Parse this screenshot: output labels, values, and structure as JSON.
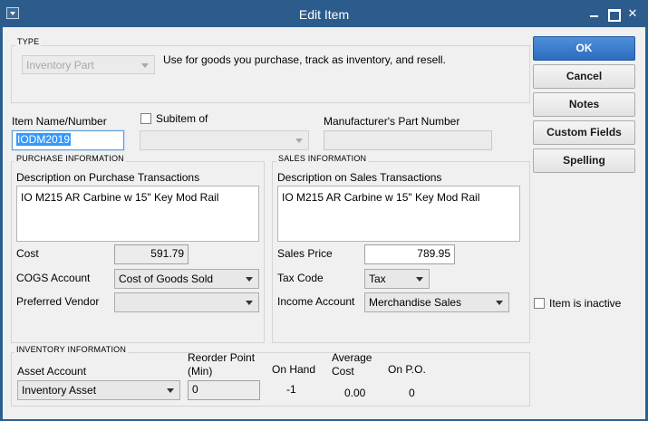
{
  "window": {
    "title": "Edit Item",
    "close_glyph": "✕"
  },
  "type_section": {
    "label": "TYPE",
    "type_value": "Inventory Part",
    "description": "Use for goods you purchase, track as inventory, and resell."
  },
  "item": {
    "name_label": "Item Name/Number",
    "name_value": "IODM2019",
    "subitem_label": "Subitem of",
    "subitem_value": "",
    "mpn_label": "Manufacturer's Part Number",
    "mpn_value": ""
  },
  "purchase": {
    "label": "PURCHASE INFORMATION",
    "desc_label": "Description on Purchase Transactions",
    "desc_value": "IO M215 AR Carbine w 15\" Key Mod Rail",
    "cost_label": "Cost",
    "cost_value": "591.79",
    "cogs_label": "COGS Account",
    "cogs_value": "Cost of Goods Sold",
    "vendor_label": "Preferred Vendor",
    "vendor_value": ""
  },
  "sales": {
    "label": "SALES INFORMATION",
    "desc_label": "Description on Sales Transactions",
    "desc_value": "IO M215 AR Carbine w 15\" Key Mod Rail",
    "price_label": "Sales Price",
    "price_value": "789.95",
    "tax_label": "Tax Code",
    "tax_value": "Tax",
    "income_label": "Income Account",
    "income_value": "Merchandise Sales"
  },
  "inventory": {
    "label": "INVENTORY INFORMATION",
    "asset_label": "Asset Account",
    "asset_value": "Inventory Asset",
    "reorder_label_1": "Reorder Point",
    "reorder_label_2": "(Min)",
    "reorder_value": "0",
    "onhand_label": "On Hand",
    "onhand_value": "-1",
    "avgcost_label_1": "Average",
    "avgcost_label_2": "Cost",
    "avgcost_value": "0.00",
    "onpo_label": "On P.O.",
    "onpo_value": "0"
  },
  "buttons": {
    "ok": "OK",
    "cancel": "Cancel",
    "notes": "Notes",
    "custom_fields": "Custom Fields",
    "spelling": "Spelling"
  },
  "inactive_label": "Item is inactive"
}
